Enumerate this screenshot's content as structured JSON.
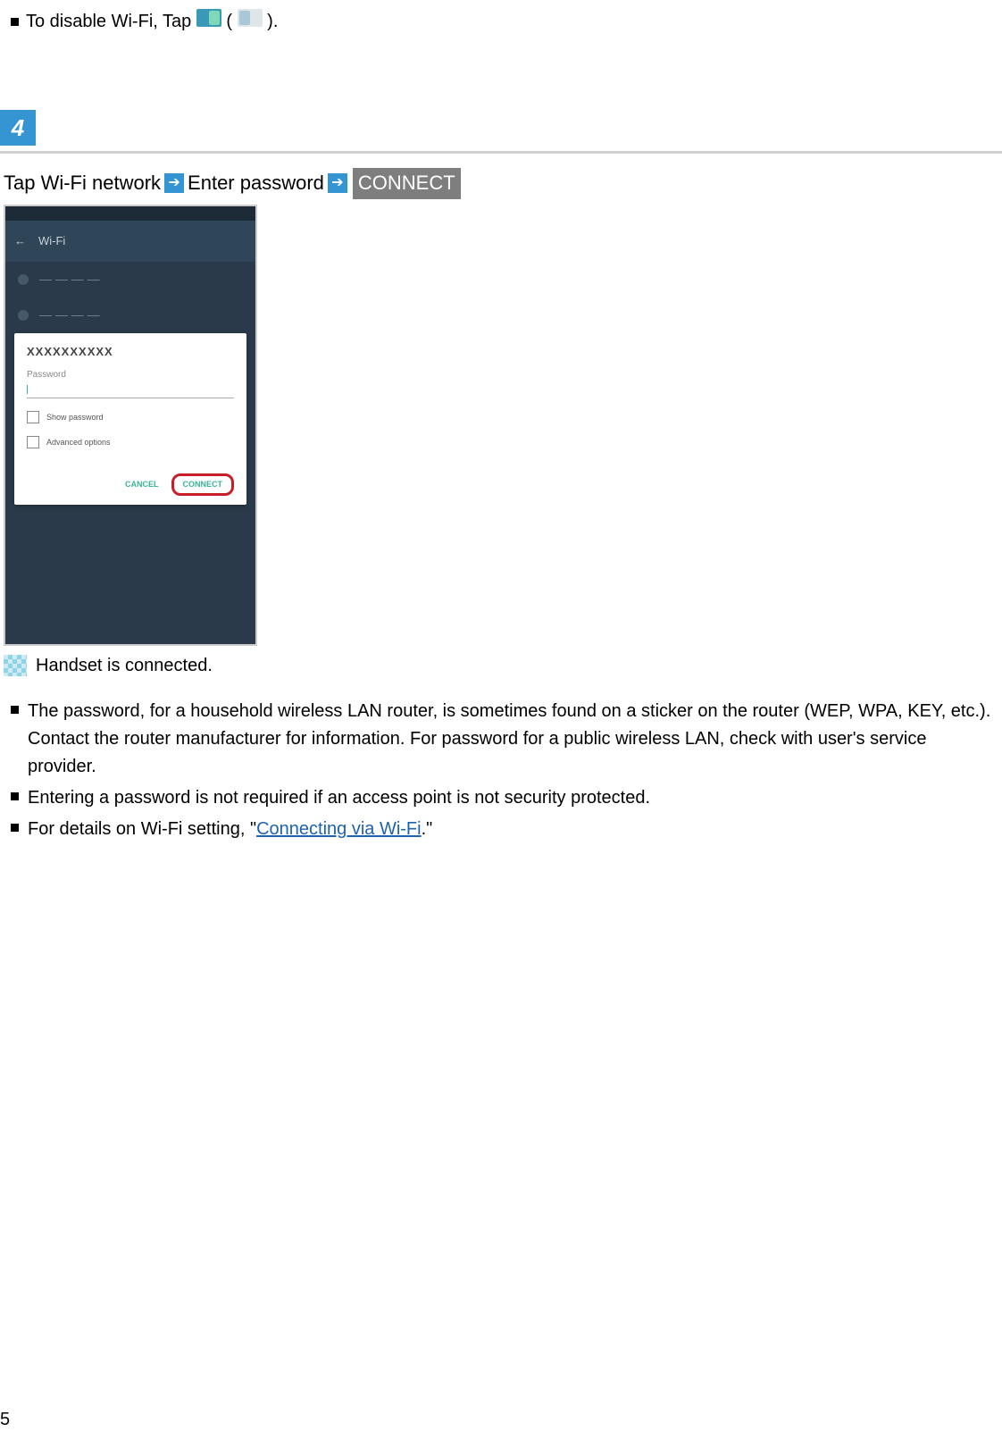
{
  "top_note": {
    "prefix": "To disable Wi-Fi, Tap ",
    "paren_open": " (",
    "paren_close": ")."
  },
  "step": {
    "number": "4",
    "line_part1": "Tap Wi-Fi network",
    "line_part2": "Enter password",
    "connect_label": "CONNECT"
  },
  "phone": {
    "dialog_title": "XXXXXXXXXX",
    "password_label": "Password",
    "show_password": "Show password",
    "advanced_options": "Advanced options",
    "cancel": "CANCEL",
    "connect": "CONNECT"
  },
  "result_text": "Handset is connected.",
  "bullets": [
    "The password, for a household wireless LAN router, is sometimes found on a sticker on the router (WEP, WPA, KEY, etc.). Contact the router manufacturer for information. For password for a public wireless LAN, check with user's service provider.",
    "Entering a password is not required if an access point is not security protected."
  ],
  "bullet3_prefix": "For details on Wi-Fi setting, \"",
  "bullet3_link": "Connecting via Wi-Fi",
  "bullet3_suffix": ".\"",
  "page_number": "5"
}
